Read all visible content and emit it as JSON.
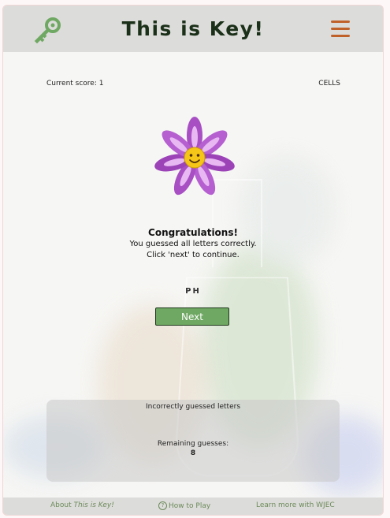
{
  "app": {
    "title": "This is Key!",
    "icon": "key-icon",
    "menu_icon": "hamburger-menu-icon",
    "accent_green": "#6fa862",
    "accent_orange": "#c0612a"
  },
  "status": {
    "score_label": "Current score: 1",
    "topic": "CELLS"
  },
  "result": {
    "illustration": "smiling-flower-icon",
    "title": "Congratulations!",
    "line1": "You guessed all letters correctly.",
    "line2": "Click 'next' to continue.",
    "word": "PH",
    "next_label": "Next"
  },
  "guesses": {
    "incorrect_label": "Incorrectly guessed letters",
    "remaining_label": "Remaining guesses:",
    "remaining_value": "8"
  },
  "footer": {
    "about_prefix": "About ",
    "about_name": "This is Key!",
    "how_to_play": "How to Play",
    "learn_more": "Learn more with WJEC"
  }
}
